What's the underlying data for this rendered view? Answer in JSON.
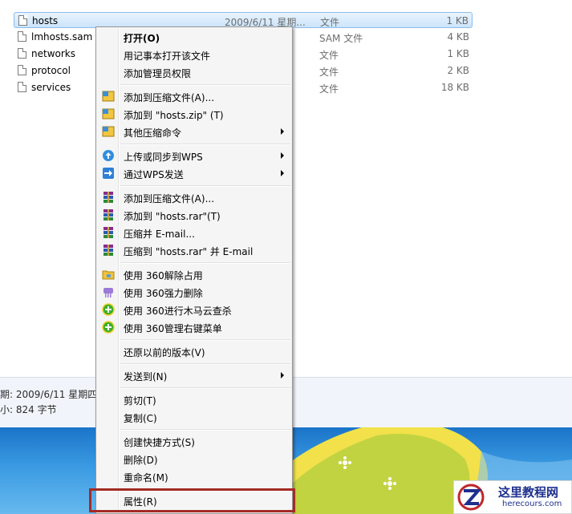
{
  "files": [
    {
      "name": "hosts",
      "date": "2009/6/11 星期...",
      "type": "文件",
      "size": "1 KB",
      "selected": true
    },
    {
      "name": "lmhosts.sam",
      "date": "",
      "type": "SAM 文件",
      "size": "4 KB",
      "selected": false
    },
    {
      "name": "networks",
      "date": "",
      "type": "文件",
      "size": "1 KB",
      "selected": false
    },
    {
      "name": "protocol",
      "date": "",
      "type": "文件",
      "size": "2 KB",
      "selected": false
    },
    {
      "name": "services",
      "date": "",
      "type": "文件",
      "size": "18 KB",
      "selected": false
    }
  ],
  "details": {
    "line1": "期: 2009/6/11 星期四",
    "line2": "小: 824 字节"
  },
  "menu": {
    "open": "打开(O)",
    "open_notepad": "用记事本打开该文件",
    "add_admin": "添加管理员权限",
    "add_archive": "添加到压缩文件(A)...",
    "add_zip": "添加到 \"hosts.zip\" (T)",
    "other_compress": "其他压缩命令",
    "upload_wps": "上传或同步到WPS",
    "send_wps": "通过WPS发送",
    "rar_add_archive": "添加到压缩文件(A)...",
    "rar_add_rar": "添加到 \"hosts.rar\"(T)",
    "rar_email": "压缩并 E-mail...",
    "rar_rar_email": "压缩到 \"hosts.rar\" 并 E-mail",
    "q360_unlock": "使用 360解除占用",
    "q360_delete": "使用 360强力删除",
    "q360_scan": "使用 360进行木马云查杀",
    "q360_manage": "使用 360管理右键菜单",
    "restore": "还原以前的版本(V)",
    "send_to": "发送到(N)",
    "cut": "剪切(T)",
    "copy": "复制(C)",
    "shortcut": "创建快捷方式(S)",
    "delete": "删除(D)",
    "rename": "重命名(M)",
    "properties": "属性(R)"
  },
  "watermark": {
    "title": "这里教程网",
    "url": "herecours.com"
  },
  "colors": {
    "highlight_box": "#a42a24",
    "selection": "#cbe4fb",
    "desktop": "#1b74c9"
  }
}
